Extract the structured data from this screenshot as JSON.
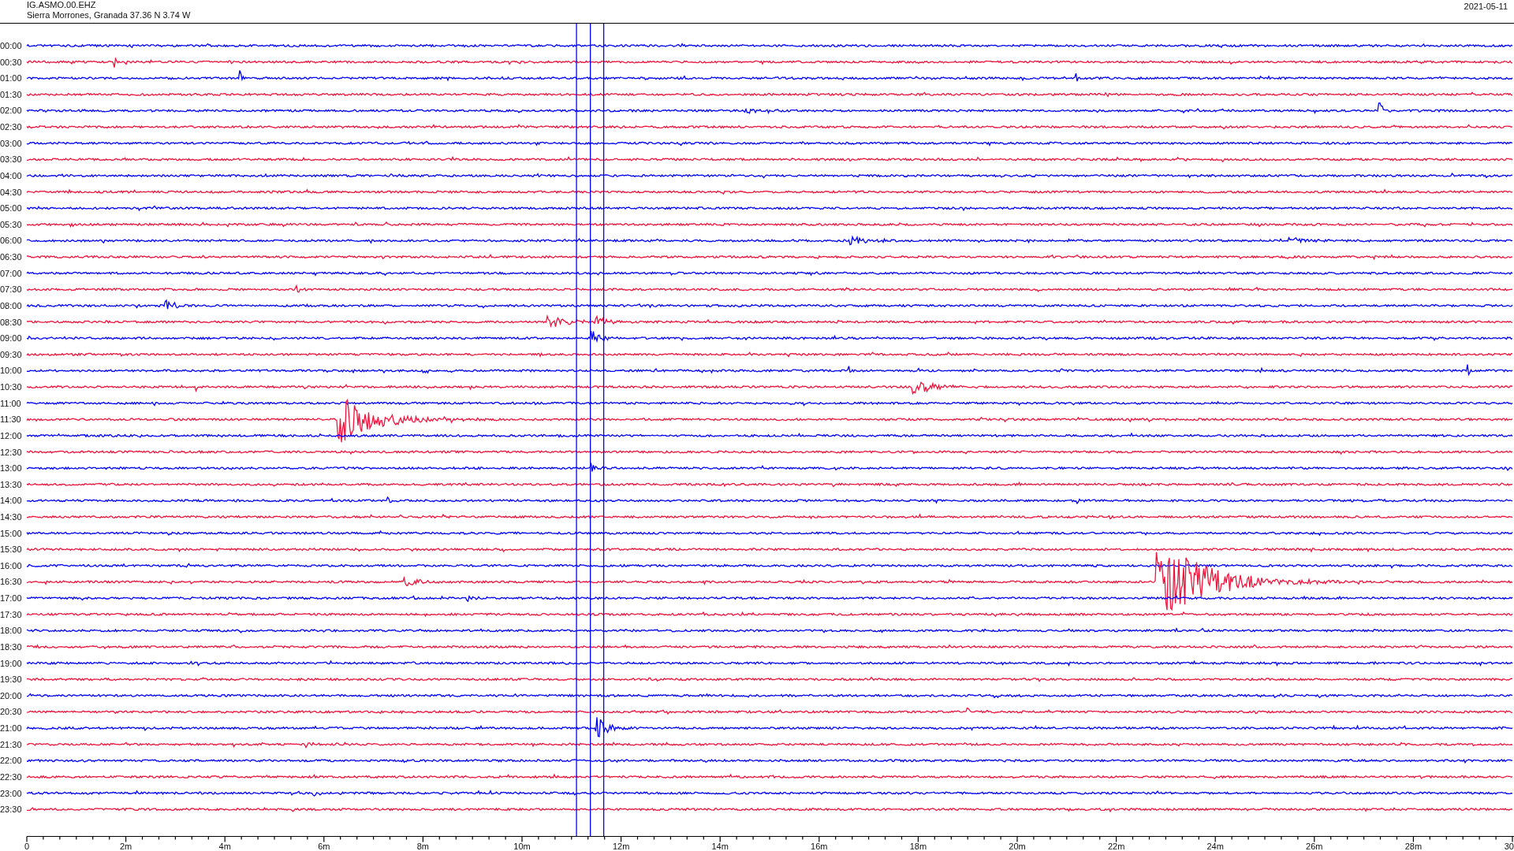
{
  "header": {
    "station": "IG.ASMO.00.EHZ",
    "location": "Sierra Morrones, Granada  37.36 N 3.74 W",
    "date": "2021-05-11"
  },
  "traces": [
    {
      "label": "00:00",
      "color": "#0000ff"
    },
    {
      "label": "00:30",
      "color": "#f0143c"
    },
    {
      "label": "01:00",
      "color": "#0000ff"
    },
    {
      "label": "01:30",
      "color": "#f0143c"
    },
    {
      "label": "02:00",
      "color": "#0000ff"
    },
    {
      "label": "02:30",
      "color": "#f0143c"
    },
    {
      "label": "03:00",
      "color": "#0000ff"
    },
    {
      "label": "03:30",
      "color": "#f0143c"
    },
    {
      "label": "04:00",
      "color": "#0000ff"
    },
    {
      "label": "04:30",
      "color": "#f0143c"
    },
    {
      "label": "05:00",
      "color": "#0000ff"
    },
    {
      "label": "05:30",
      "color": "#f0143c"
    },
    {
      "label": "06:00",
      "color": "#0000ff"
    },
    {
      "label": "06:30",
      "color": "#f0143c"
    },
    {
      "label": "07:00",
      "color": "#0000ff"
    },
    {
      "label": "07:30",
      "color": "#f0143c"
    },
    {
      "label": "08:00",
      "color": "#0000ff"
    },
    {
      "label": "08:30",
      "color": "#f0143c"
    },
    {
      "label": "09:00",
      "color": "#0000ff"
    },
    {
      "label": "09:30",
      "color": "#f0143c"
    },
    {
      "label": "10:00",
      "color": "#0000ff"
    },
    {
      "label": "10:30",
      "color": "#f0143c"
    },
    {
      "label": "11:00",
      "color": "#0000ff"
    },
    {
      "label": "11:30",
      "color": "#f0143c"
    },
    {
      "label": "12:00",
      "color": "#0000ff"
    },
    {
      "label": "12:30",
      "color": "#f0143c"
    },
    {
      "label": "13:00",
      "color": "#0000ff"
    },
    {
      "label": "13:30",
      "color": "#f0143c"
    },
    {
      "label": "14:00",
      "color": "#0000ff"
    },
    {
      "label": "14:30",
      "color": "#f0143c"
    },
    {
      "label": "15:00",
      "color": "#0000ff"
    },
    {
      "label": "15:30",
      "color": "#f0143c"
    },
    {
      "label": "16:00",
      "color": "#0000ff"
    },
    {
      "label": "16:30",
      "color": "#f0143c"
    },
    {
      "label": "17:00",
      "color": "#0000ff"
    },
    {
      "label": "17:30",
      "color": "#f0143c"
    },
    {
      "label": "18:00",
      "color": "#0000ff"
    },
    {
      "label": "18:30",
      "color": "#f0143c"
    },
    {
      "label": "19:00",
      "color": "#0000ff"
    },
    {
      "label": "19:30",
      "color": "#f0143c"
    },
    {
      "label": "20:00",
      "color": "#0000ff"
    },
    {
      "label": "20:30",
      "color": "#f0143c"
    },
    {
      "label": "21:00",
      "color": "#0000ff"
    },
    {
      "label": "21:30",
      "color": "#f0143c"
    },
    {
      "label": "22:00",
      "color": "#0000ff"
    },
    {
      "label": "22:30",
      "color": "#f0143c"
    },
    {
      "label": "23:00",
      "color": "#0000ff"
    },
    {
      "label": "23:30",
      "color": "#f0143c"
    }
  ],
  "x_axis": {
    "ticks": [
      "0",
      "2m",
      "4m",
      "6m",
      "8m",
      "10m",
      "12m",
      "14m",
      "16m",
      "18m",
      "20m",
      "22m",
      "24m",
      "26m",
      "28m",
      "30"
    ]
  }
}
